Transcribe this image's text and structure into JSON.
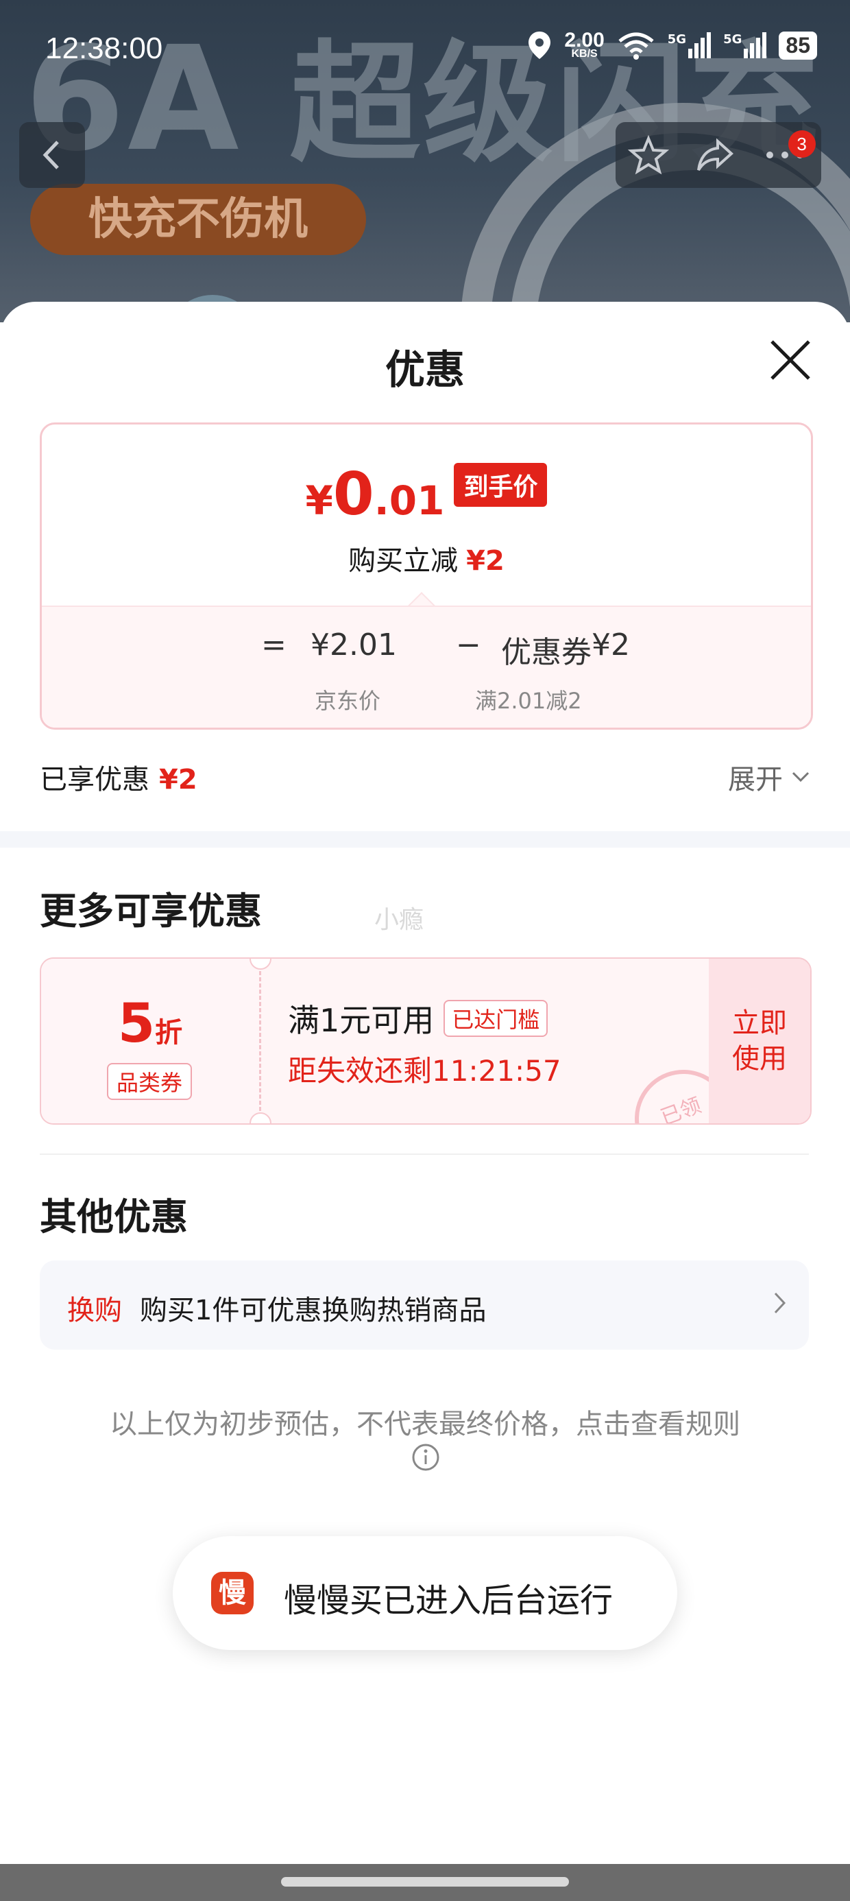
{
  "status_bar": {
    "time": "12:38:00",
    "net_speed": "2.00",
    "net_unit": "KB/S",
    "signal_1": "5G",
    "signal_2": "5G",
    "battery": "85"
  },
  "background": {
    "headline": "6A 超级闪充",
    "headline_big": "6A",
    "headline_rest": "超级闪充",
    "pill_text": "快充不伤机",
    "cart_badge": "3"
  },
  "sheet": {
    "title": "优惠",
    "price": {
      "currency": "¥",
      "integer": "0",
      "decimal": ".01",
      "tag": "到手价",
      "reduce_label": "购买立减",
      "reduce_amount": "¥2"
    },
    "calc": {
      "equals": "=",
      "base_price": "¥2.01",
      "minus": "−",
      "coupon_label": "优惠券",
      "coupon_amount": "¥2",
      "base_caption": "京东价",
      "coupon_caption": "满2.01减2"
    },
    "enjoyed": {
      "label": "已享优惠",
      "amount": "¥2"
    },
    "expand_label": "展开",
    "more_title": "更多可享优惠",
    "watermark": "小瘾",
    "coupon": {
      "value": "5",
      "unit": "折",
      "type": "品类券",
      "condition": "满1元可用",
      "status_tag": "已达门槛",
      "timer": "距失效还剩11:21:57",
      "action_line1": "立即",
      "action_line2": "使用",
      "stamp": "已领"
    },
    "other_title": "其他优惠",
    "other": {
      "tag": "换购",
      "text": "购买1件可优惠换购热销商品"
    },
    "disclaimer": "以上仅为初步预估，不代表最终价格，点击查看规则"
  },
  "toast": {
    "icon_char": "慢",
    "text": "慢慢买已进入后台运行"
  },
  "colors": {
    "accent": "#e2231a",
    "card_border": "#f6c9cf",
    "card_bg": "#fff5f6"
  }
}
